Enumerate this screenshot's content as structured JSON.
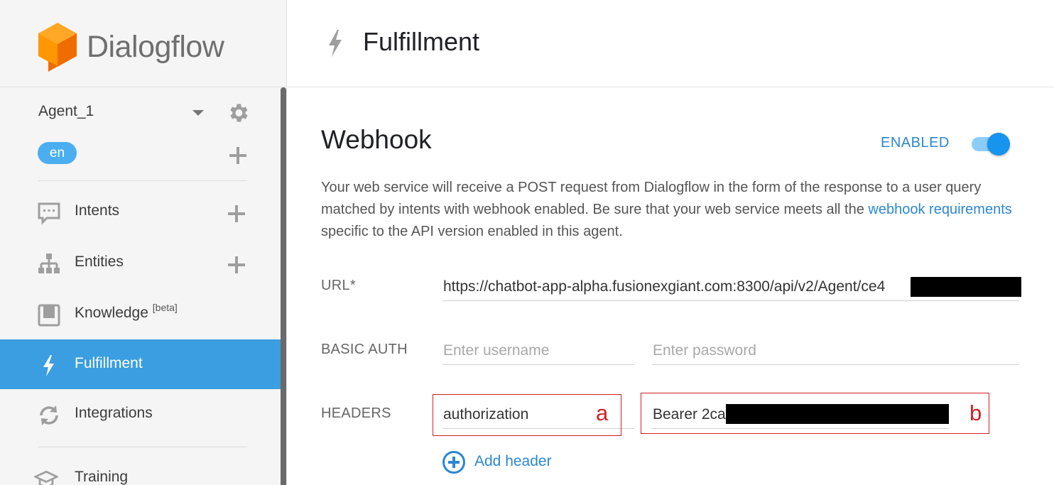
{
  "brand": {
    "name": "Dialogflow"
  },
  "agent": {
    "name": "Agent_1",
    "language": "en"
  },
  "nav": [
    {
      "label": "Intents",
      "icon": "chat-bubble-icon",
      "has_add": true
    },
    {
      "label": "Entities",
      "icon": "hierarchy-icon",
      "has_add": true
    },
    {
      "label": "Knowledge",
      "badge": "[beta]",
      "icon": "book-icon"
    },
    {
      "label": "Fulfillment",
      "icon": "bolt-icon",
      "active": true
    },
    {
      "label": "Integrations",
      "icon": "sync-icon"
    },
    {
      "label": "Training",
      "icon": "graduation-cap-icon"
    }
  ],
  "header": {
    "title": "Fulfillment"
  },
  "webhook": {
    "title": "Webhook",
    "status_label": "ENABLED",
    "enabled": true,
    "description_prefix": "Your web service will receive a POST request from Dialogflow in the form of the response to a user query matched by intents with webhook enabled. Be sure that your web service meets all the ",
    "description_link": "webhook requirements",
    "description_suffix": " specific to the API version enabled in this agent.",
    "url_label": "URL*",
    "url_value": "https://chatbot-app-alpha.fusionexgiant.com:8300/api/v2/Agent/ce4",
    "basic_auth_label": "BASIC AUTH",
    "username_placeholder": "Enter username",
    "password_placeholder": "Enter password",
    "headers_label": "HEADERS",
    "header_key": "authorization",
    "header_value": "Bearer 2ca",
    "add_header_label": "Add header"
  },
  "annotations": {
    "a": "a",
    "b": "b"
  },
  "colors": {
    "accent": "#2b87d1",
    "active_nav": "#3a9ee0",
    "toggle_knob": "#1694ee",
    "annotation_red": "#d01f24",
    "logo_orange": "#f57c00"
  }
}
